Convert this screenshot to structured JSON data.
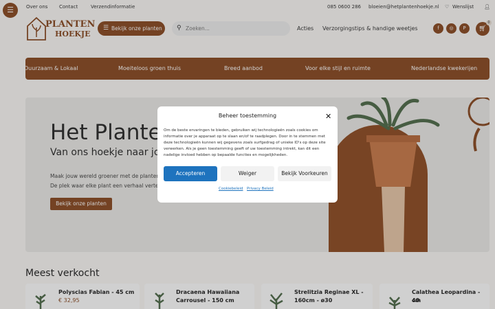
{
  "topbar": {
    "about": "Over ons",
    "contact": "Contact",
    "shipping": "Verzendinformatie",
    "phone": "085 0600 286",
    "email": "bloeien@hetplantenhoekje.nl",
    "wishlist": "Wenslijst"
  },
  "logo": {
    "line1": "PLANTEN",
    "line2": "HOEKJE"
  },
  "header": {
    "category_button": "Bekijk onze planten",
    "search_placeholder": "Zoeken...",
    "nav": [
      "Acties",
      "Verzorgingstips & handige weetjes"
    ],
    "cart_count": "0"
  },
  "usp_band": [
    "Duurzaam & Lokaal",
    "Moeiteloos groen thuis",
    "Breed aanbod",
    "Voor elke stijl en ruimte",
    "Nederlandse kwekerijen"
  ],
  "hero": {
    "title": "Het Planten",
    "subtitle": "Van ons hoekje naar jou",
    "text1": "Maak jouw wereld groener met de planten",
    "text2": "De plek waar elke plant een verhaal vertelt",
    "button": "Bekijk onze planten"
  },
  "consent": {
    "title": "Beheer toestemming",
    "body": "Om de beste ervaringen te bieden, gebruiken wij technologieën zoals cookies om informatie over je apparaat op te slaan en/of te raadplegen. Door in te stemmen met deze technologieën kunnen wij gegevens zoals surfgedrag of unieke ID's op deze site verwerken. Als je geen toestemming geeft of uw toestemming intrekt, kan dit een nadelige invloed hebben op bepaalde functies en mogelijkheden.",
    "accept": "Accepteren",
    "deny": "Weiger",
    "preferences": "Bekijk Voorkeuren",
    "cookie_policy": "Cookiebeleid",
    "privacy_policy": "Privacy Beleid"
  },
  "bestsellers": {
    "title": "Meest verkocht",
    "products": [
      {
        "name_line1": "Polyscias Fabian - 45 cm",
        "name_line2": "",
        "price": "€ 32,95"
      },
      {
        "name_line1": "Dracaena Hawaiiana",
        "name_line2": "Carrousel - 150 cm",
        "price": ""
      },
      {
        "name_line1": "Strelitzia Reginae XL -",
        "name_line2": "160cm - ø30",
        "price": ""
      },
      {
        "name_line1": "Calathea Leopardina - 40",
        "name_line2": "cm",
        "price": ""
      }
    ]
  },
  "colors": {
    "brand": "#8a4a22",
    "accept_button": "#1e73be"
  }
}
